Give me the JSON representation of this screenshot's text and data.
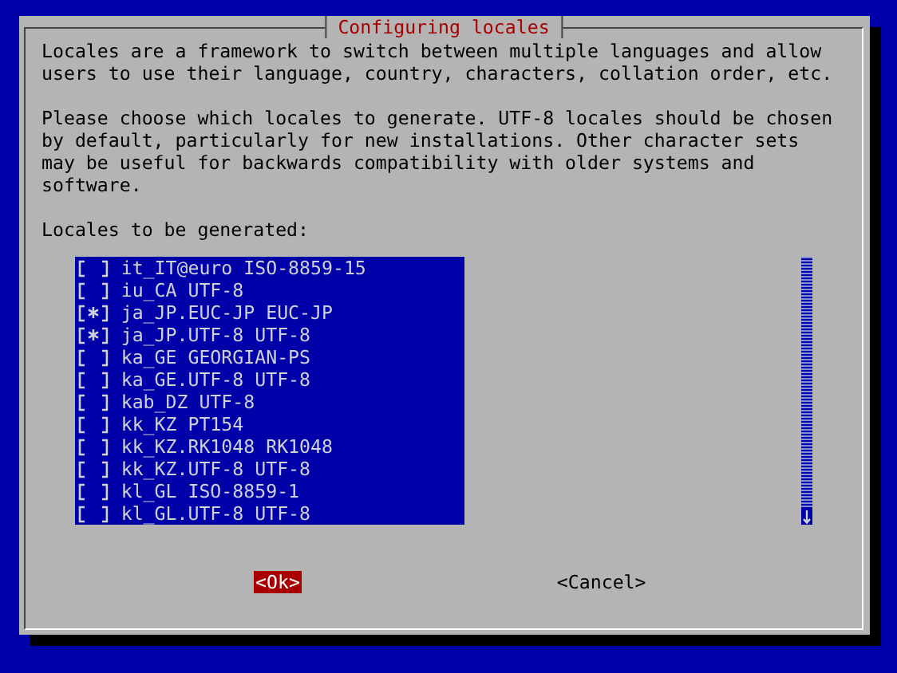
{
  "dialog": {
    "title": "Configuring locales",
    "paragraphs": [
      "Locales are a framework to switch between multiple languages and allow users to use their language, country, characters, collation order, etc.",
      "Please choose which locales to generate. UTF-8 locales should be chosen by default, particularly for new installations. Other character sets may be useful for backwards compatibility with older systems and software."
    ],
    "list_label": "Locales to be generated:",
    "items": [
      {
        "label": "it_IT@euro ISO-8859-15",
        "checked": false
      },
      {
        "label": "iu_CA UTF-8",
        "checked": false
      },
      {
        "label": "ja_JP.EUC-JP EUC-JP",
        "checked": true
      },
      {
        "label": "ja_JP.UTF-8 UTF-8",
        "checked": true
      },
      {
        "label": "ka_GE GEORGIAN-PS",
        "checked": false
      },
      {
        "label": "ka_GE.UTF-8 UTF-8",
        "checked": false
      },
      {
        "label": "kab_DZ UTF-8",
        "checked": false
      },
      {
        "label": "kk_KZ PT154",
        "checked": false
      },
      {
        "label": "kk_KZ.RK1048 RK1048",
        "checked": false
      },
      {
        "label": "kk_KZ.UTF-8 UTF-8",
        "checked": false
      },
      {
        "label": "kl_GL ISO-8859-1",
        "checked": false
      },
      {
        "label": "kl_GL.UTF-8 UTF-8",
        "checked": false
      }
    ],
    "buttons": [
      {
        "label": "<Ok>",
        "selected": true
      },
      {
        "label": "<Cancel>",
        "selected": false
      }
    ]
  }
}
